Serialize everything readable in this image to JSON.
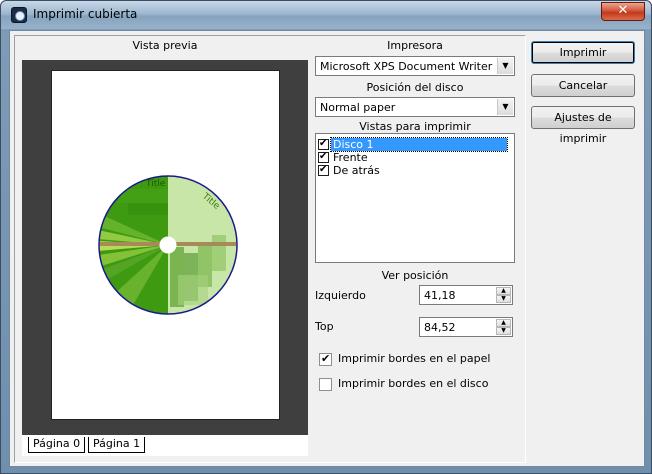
{
  "window": {
    "title": "Imprimir cubierta",
    "close_glyph": "✕"
  },
  "preview": {
    "heading": "Vista previa",
    "disc_title": "Title",
    "tabs": [
      {
        "label": "Página 0"
      },
      {
        "label": "Página 1"
      }
    ]
  },
  "printer": {
    "label": "Impresora",
    "selected": "Microsoft XPS Document Writer"
  },
  "disc_position": {
    "label": "Posición del disco",
    "selected": "Normal paper"
  },
  "views": {
    "label": "Vistas para imprimir",
    "items": [
      {
        "label": "Disco 1",
        "checked": true,
        "selected": true
      },
      {
        "label": "Frente",
        "checked": true,
        "selected": false
      },
      {
        "label": "De atrás",
        "checked": true,
        "selected": false
      }
    ]
  },
  "position": {
    "label": "Ver posición",
    "left_label": "Izquierdo",
    "left_value": "41,18",
    "top_label": "Top",
    "top_value": "84,52"
  },
  "options": {
    "print_paper_borders": {
      "label": "Imprimir bordes en el papel",
      "checked": true
    },
    "print_disc_borders": {
      "label": "Imprimir bordes en el disco",
      "checked": false
    }
  },
  "buttons": {
    "print": "Imprimir",
    "cancel": "Cancelar",
    "print_settings": "Ajustes de imprimir"
  },
  "colors": {
    "disc_dark": "#3e9a10",
    "disc_light": "#c8e6a8",
    "disc_border": "#1a1a8a",
    "selection": "#3399ff"
  }
}
